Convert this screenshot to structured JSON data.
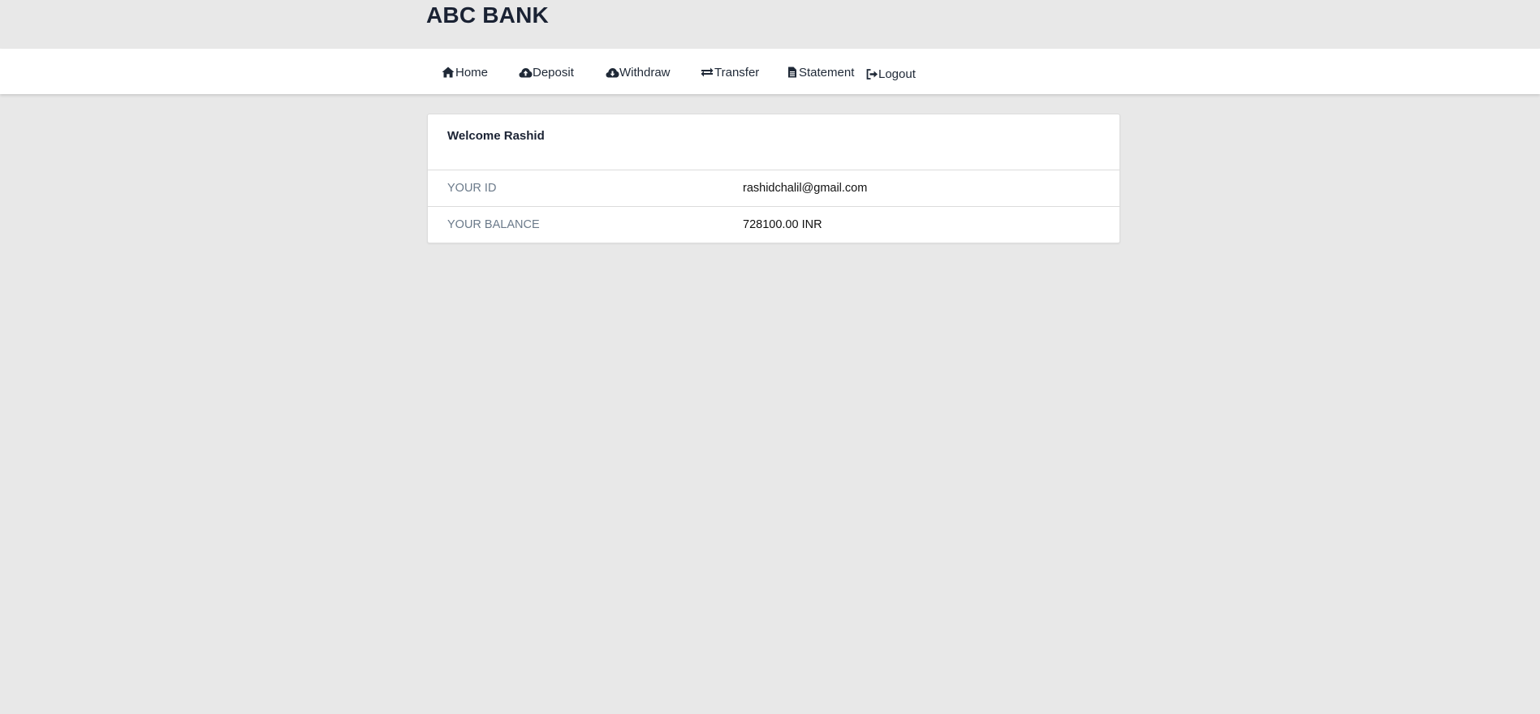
{
  "brand": {
    "title": "ABC BANK"
  },
  "nav": {
    "items": [
      {
        "label": "Home",
        "icon": "home-icon"
      },
      {
        "label": "Deposit",
        "icon": "cloud-upload-icon"
      },
      {
        "label": "Withdraw",
        "icon": "cloud-download-icon"
      },
      {
        "label": "Transfer",
        "icon": "transfer-arrows-icon"
      },
      {
        "label": "Statement",
        "icon": "document-icon"
      },
      {
        "label": "Logout",
        "icon": "sign-out-icon"
      }
    ]
  },
  "account": {
    "welcome": "Welcome Rashid",
    "rows": [
      {
        "label": "YOUR ID",
        "value": "rashidchalil@gmail.com"
      },
      {
        "label": "YOUR BALANCE",
        "value": "728100.00 INR"
      }
    ]
  },
  "colors": {
    "page_background": "#e8e8e8",
    "text_dark": "#1a2233",
    "label_muted": "#6b7a8a"
  }
}
